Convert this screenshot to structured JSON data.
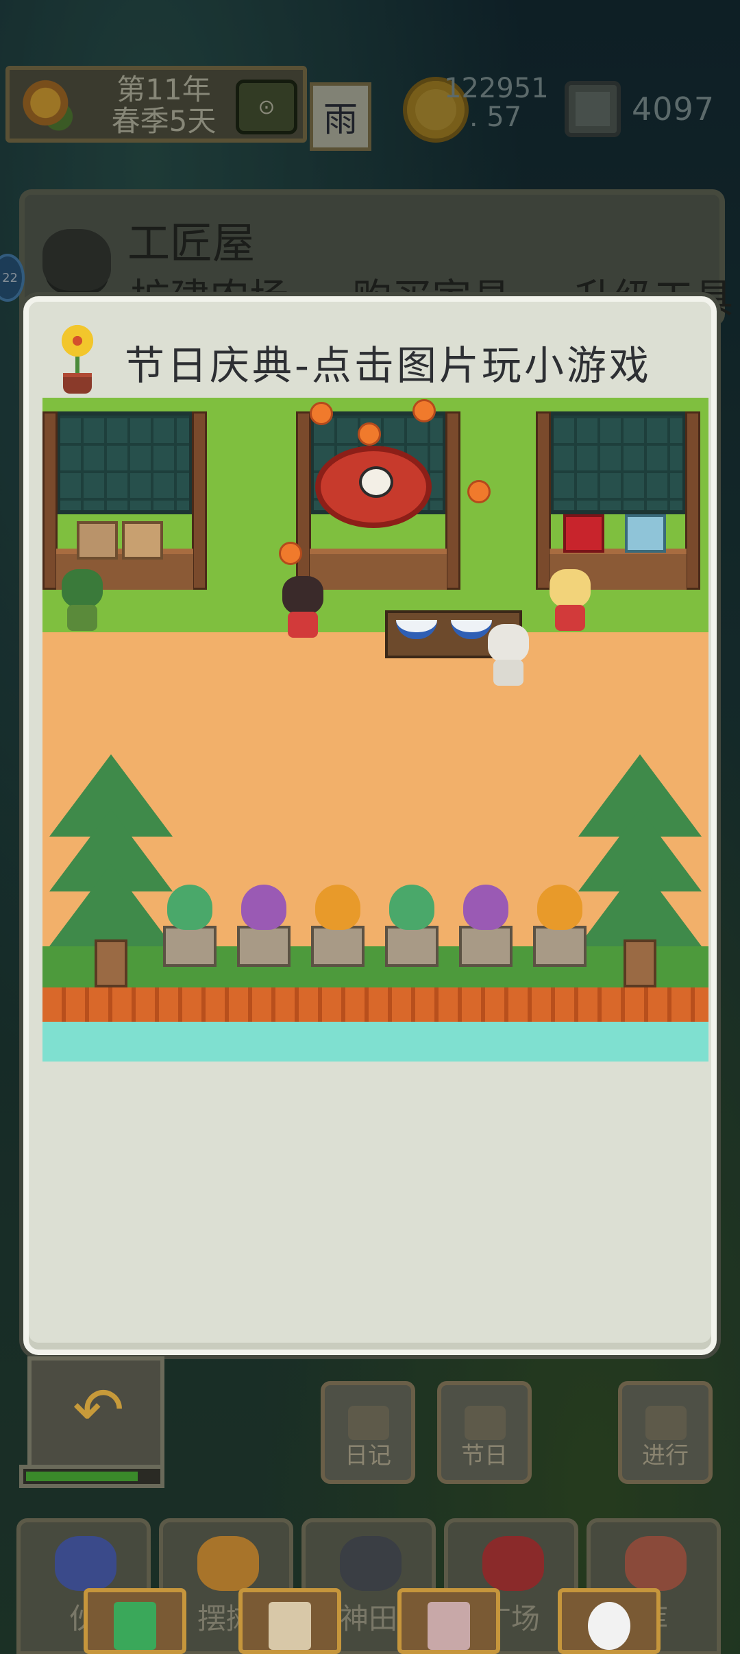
{
  "status_bar": {
    "year_label": "第11年",
    "season_day_label": "春季5天",
    "weather_label": "雨",
    "coins_line1": "122951",
    "coins_line2": ". 57",
    "gems": "4097"
  },
  "workshop": {
    "title": "工匠屋",
    "links": [
      "扩建农场",
      "购买家具",
      "升级工具"
    ],
    "side_badge": "22"
  },
  "modal": {
    "title": "节日庆典-点击图片玩小游戏",
    "scene_alt": "festival-scene"
  },
  "controls": {
    "diary_label": "日记",
    "festival_label": "节日",
    "proceed_label": "进行",
    "progress_fraction": 0.85
  },
  "nav_tabs": [
    {
      "label": "伙"
    },
    {
      "label": "摆摊"
    },
    {
      "label": "神田"
    },
    {
      "label": "广场"
    },
    {
      "label": "库"
    }
  ],
  "colors": {
    "modal_bg": "#dcdfd3",
    "modal_border": "#f2f3ec",
    "grass": "#7fbf3f",
    "dirt": "#f2b06a",
    "water": "#7fe0d0",
    "coin": "#c9a43a"
  }
}
